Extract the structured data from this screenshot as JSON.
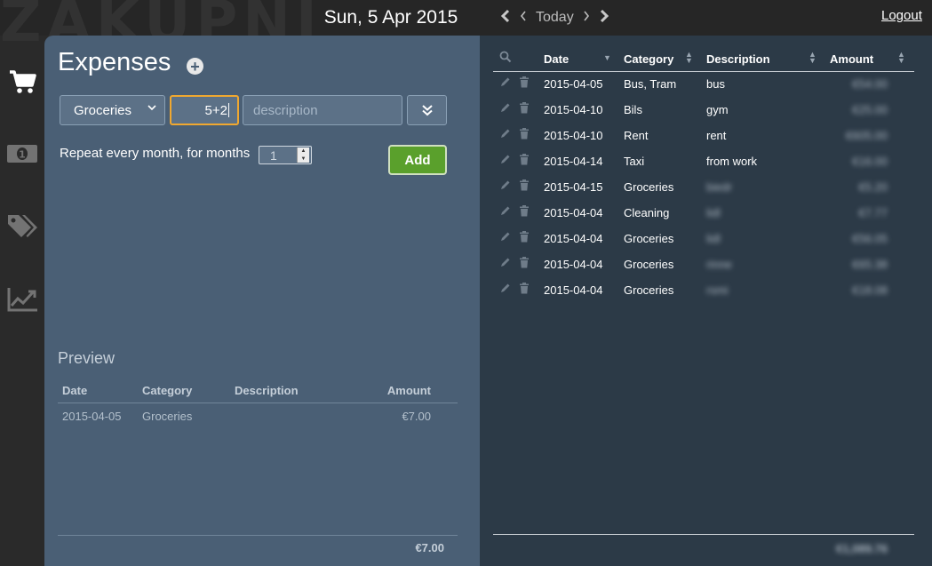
{
  "header": {
    "watermark": "ZAKUPNIK",
    "date": "Sun, 5 Apr 2015",
    "today_label": "Today",
    "logout_label": "Logout"
  },
  "sidebar": {
    "items": [
      {
        "icon": "cart-icon",
        "active": true
      },
      {
        "icon": "money-icon",
        "active": false
      },
      {
        "icon": "tags-icon",
        "active": false
      },
      {
        "icon": "chart-icon",
        "active": false
      }
    ]
  },
  "form": {
    "title": "Expenses",
    "category_value": "Groceries",
    "amount_value": "5+2",
    "description_placeholder": "description",
    "repeat_label": "Repeat every month, for months",
    "months_value": "1",
    "add_label": "Add"
  },
  "preview": {
    "title": "Preview",
    "columns": [
      "Date",
      "Category",
      "Description",
      "Amount"
    ],
    "rows": [
      {
        "date": "2015-04-05",
        "category": "Groceries",
        "description": "",
        "amount": "€7.00"
      }
    ],
    "total": "€7.00"
  },
  "expenses": {
    "columns": [
      "Date",
      "Category",
      "Description",
      "Amount"
    ],
    "rows": [
      {
        "date": "2015-04-05",
        "category": "Bus, Tram",
        "description": "bus",
        "amount": "€54.00"
      },
      {
        "date": "2015-04-10",
        "category": "Bils",
        "description": "gym",
        "amount": "€25.00"
      },
      {
        "date": "2015-04-10",
        "category": "Rent",
        "description": "rent",
        "amount": "€605.00"
      },
      {
        "date": "2015-04-14",
        "category": "Taxi",
        "description": "from work",
        "amount": "€16.00"
      },
      {
        "date": "2015-04-15",
        "category": "Groceries",
        "description": "biedr",
        "amount": "€5.20"
      },
      {
        "date": "2015-04-04",
        "category": "Cleaning",
        "description": "lidl",
        "amount": "€7.77"
      },
      {
        "date": "2015-04-04",
        "category": "Groceries",
        "description": "lidl",
        "amount": "€56.05"
      },
      {
        "date": "2015-04-04",
        "category": "Groceries",
        "description": "rinne",
        "amount": "€65.38"
      },
      {
        "date": "2015-04-04",
        "category": "Groceries",
        "description": "rsmi",
        "amount": "€18.08"
      }
    ],
    "total": "€1,089.76"
  }
}
